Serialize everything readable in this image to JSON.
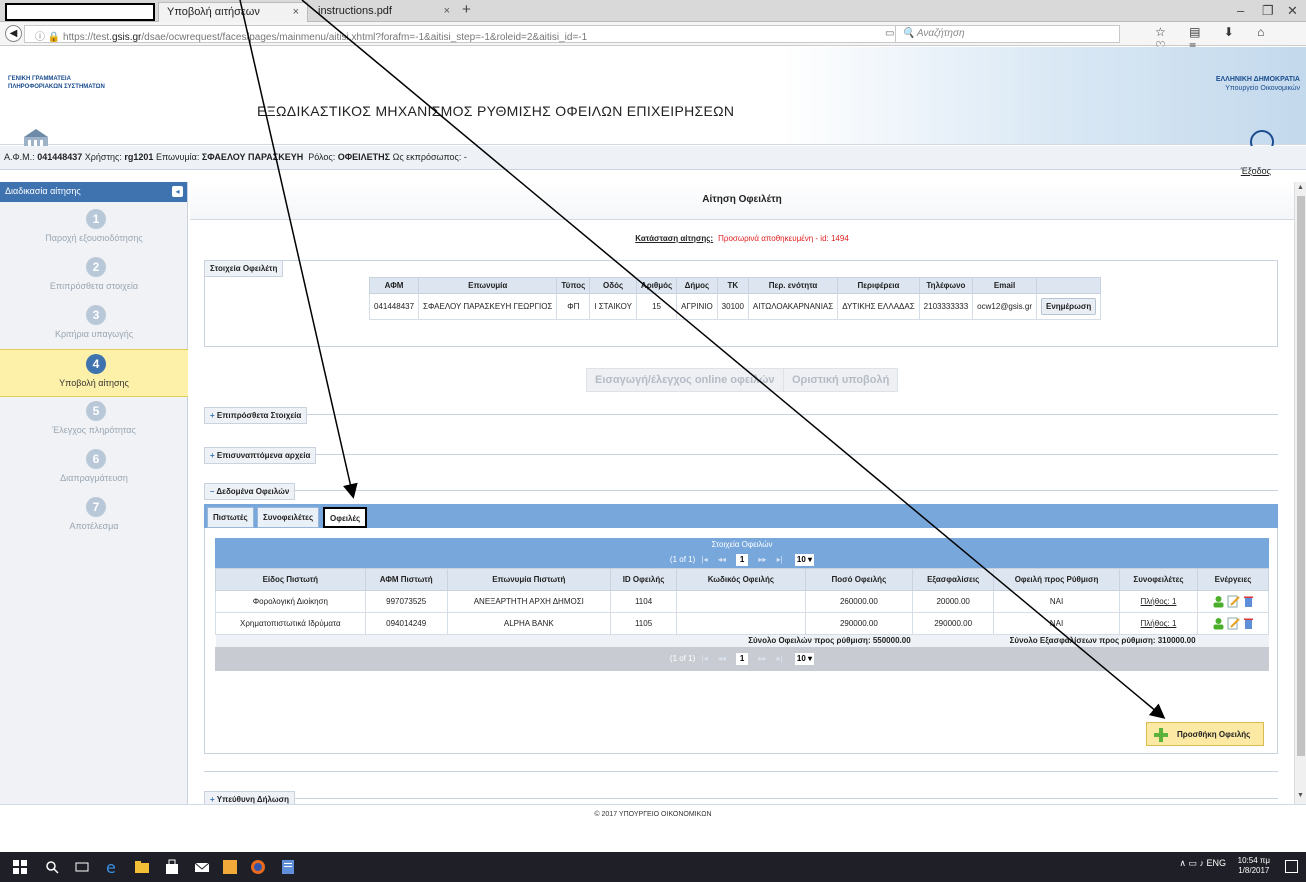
{
  "browser": {
    "tabs": [
      {
        "label": "Υποβολή αιτήσεων"
      },
      {
        "label": "instructions.pdf"
      }
    ],
    "url_prefix": "https://test.",
    "url_domain": "gsis.gr",
    "url_rest": "/dsae/ocwrequest/faces/pages/mainmenu/aitisi.xhtml?forafm=-1&aitisi_step=-1&roleid=2&aitisi_id=-1",
    "search_placeholder": "Αναζήτηση",
    "new_tab": "+",
    "close": "×"
  },
  "header": {
    "org_left_1": "ΓΕΝΙΚΗ ΓΡΑΜΜΑΤΕΙΑ",
    "org_left_2": "ΠΛΗΡΟΦΟΡΙΑΚΩΝ ΣΥΣΤΗΜΑΤΩΝ",
    "title": "ΕΞΩΔΙΚΑΣΤΙΚΟΣ ΜΗΧΑΝΙΣΜΟΣ ΡΥΘΜΙΣΗΣ ΟΦΕΙΛΩΝ ΕΠΙΧΕΙΡΗΣΕΩΝ",
    "org_right_1": "ΕΛΛΗΝΙΚΗ ΔΗΜΟΚΡΑΤΙΑ",
    "org_right_2": "Υπουργείο Οικονομικών"
  },
  "userbar": {
    "afm_label": "Α.Φ.Μ.:",
    "afm_value": "041448437",
    "user_label": "Χρήστης:",
    "user_value": "rg1201",
    "name_label": "Επωνυμία:",
    "name_value": "ΣΦΑΕΛΟΥ ΠΑΡΑΣΚΕΥΗ",
    "role_label": "Ρόλος:",
    "role_value": "ΟΦΕΙΛΕΤΗΣ",
    "rep_label": "Ως εκπρόσωπος:",
    "rep_value": "-",
    "logout": "Έξοδος"
  },
  "sidebar": {
    "title": "Διαδικασία αίτησης",
    "toggle": "◂",
    "steps": [
      {
        "num": "1",
        "label": "Παροχή εξουσιοδότησης"
      },
      {
        "num": "2",
        "label": "Επιπρόσθετα στοιχεία"
      },
      {
        "num": "3",
        "label": "Κριτήρια υπαγωγής"
      },
      {
        "num": "4",
        "label": "Υποβολή αίτησης"
      },
      {
        "num": "5",
        "label": "Έλεγχος πληρότητας"
      },
      {
        "num": "6",
        "label": "Διαπραγμάτευση"
      },
      {
        "num": "7",
        "label": "Αποτέλεσμα"
      }
    ]
  },
  "main": {
    "title": "Αίτηση Οφειλέτη",
    "status_label": "Κατάσταση αίτησης:",
    "status_value": "Προσωρινά αποθηκευμένη - id: 1494",
    "debtor_section": "Στοιχεία Οφειλέτη",
    "debtor_headers": [
      "ΑΦΜ",
      "Επωνυμία",
      "Τύπος",
      "Οδός",
      "Αριθμός",
      "Δήμος",
      "ΤΚ",
      "Περ. ενότητα",
      "Περιφέρεια",
      "Τηλέφωνο",
      "Email"
    ],
    "debtor_row": [
      "041448437",
      "ΣΦΑΕΛΟΥ ΠΑΡΑΣΚΕΥΗ ΓΕΩΡΓΙΟΣ",
      "ΦΠ",
      "Ι ΣΤΑΙΚΟΥ",
      "15",
      "ΑΓΡΙΝΙΟ",
      "30100",
      "ΑΙΤΩΛΟΑΚΑΡΝΑΝΙΑΣ",
      "ΔΥΤΙΚΗΣ ΕΛΛΑΔΑΣ",
      "2103333333",
      "ocw12@gsis.gr"
    ],
    "update_button": "Ενημέρωση",
    "btn_online": "Εισαγωγή/έλεγχος online οφειλών",
    "btn_submit": "Οριστική υποβολή",
    "sec_extra": "Επιπρόσθετα Στοιχεία",
    "sec_files": "Επισυναπτόμενα αρχεία",
    "sec_debts": "Δεδομένα Οφειλών",
    "sec_declaration": "Υπεύθυνη Δήλωση",
    "tabs": [
      "Πιστωτές",
      "Συνοφειλέτες",
      "Οφειλές"
    ],
    "grid_caption": "Στοιχεία Οφειλών",
    "pager_info": "(1 of 1)",
    "pager_page": "1",
    "pager_rows": "10",
    "columns": [
      "Είδος Πιστωτή",
      "ΑΦΜ Πιστωτή",
      "Επωνυμία Πιστωτή",
      "ID Οφειλής",
      "Κωδικός Οφειλής",
      "Ποσό Οφειλής",
      "Εξασφαλίσεις",
      "Οφειλή προς Ρύθμιση",
      "Συνοφειλέτες",
      "Ενέργειες"
    ],
    "rows": [
      [
        "Φορολογική Διοίκηση",
        "997073525",
        "ΑΝΕΞΑΡΤΗΤΗ ΑΡΧΗ ΔΗΜΟΣΙ",
        "1104",
        "",
        "260000.00",
        "20000.00",
        "ΝΑΙ",
        "Πλήθος: 1"
      ],
      [
        "Χρηματοπιστωτικά Ιδρύματα",
        "094014249",
        "ALPHA BANK",
        "1105",
        "",
        "290000.00",
        "290000.00",
        "ΝΑΙ",
        "Πλήθος: 1"
      ]
    ],
    "sum_debts": "Σύνολο Οφειλών προς ρύθμιση: 550000.00",
    "sum_collateral": "Σύνολο Εξασφαλίσεων προς ρύθμιση: 310000.00",
    "add_debt": "Προσθήκη Οφειλής"
  },
  "footer": {
    "copyright": "© 2017 ΥΠΟΥΡΓΕΙΟ ΟΙΚΟΝΟΜΙΚΩΝ"
  },
  "taskbar": {
    "lang": "ENG",
    "time": "10:54 πμ",
    "date": "1/8/2017"
  },
  "colors": {
    "accent": "#3e73b0",
    "grid_blue": "#78a7dc",
    "active_step": "#fdf0a8",
    "status_red": "#e02020"
  }
}
